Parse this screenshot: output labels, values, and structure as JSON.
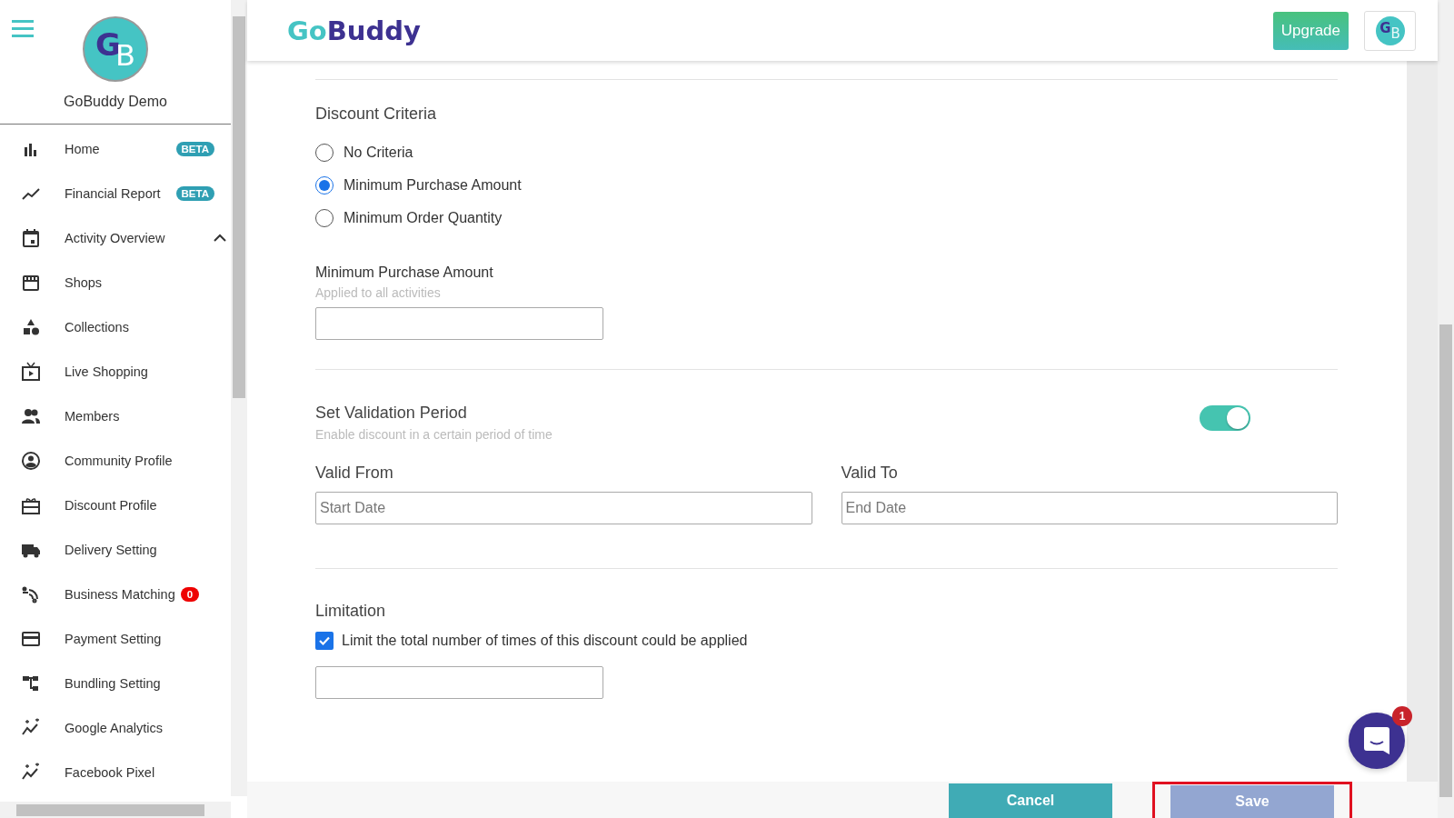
{
  "sidebar": {
    "profile_name": "GoBuddy Demo",
    "avatar_letters": [
      "G",
      "B"
    ],
    "items": [
      {
        "label": "Home",
        "kind": "beta",
        "badge": "BETA"
      },
      {
        "label": "Financial Report",
        "kind": "beta",
        "badge": "BETA"
      },
      {
        "label": "Activity Overview",
        "kind": "group",
        "expanded": true
      },
      {
        "label": "Shops",
        "kind": "plain"
      },
      {
        "label": "Collections",
        "kind": "plain"
      },
      {
        "label": "Live Shopping",
        "kind": "plain"
      },
      {
        "label": "Members",
        "kind": "plain"
      },
      {
        "label": "Community Profile",
        "kind": "plain"
      },
      {
        "label": "Discount Profile",
        "kind": "plain"
      },
      {
        "label": "Delivery Setting",
        "kind": "plain"
      },
      {
        "label": "Business Matching",
        "kind": "counter",
        "badge": "0"
      },
      {
        "label": "Payment Setting",
        "kind": "plain"
      },
      {
        "label": "Bundling Setting",
        "kind": "plain"
      },
      {
        "label": "Google Analytics",
        "kind": "plain"
      },
      {
        "label": "Facebook Pixel",
        "kind": "plain"
      }
    ]
  },
  "header": {
    "logo_parts": [
      "Go",
      "Buddy"
    ],
    "upgrade_button": "Upgrade",
    "avatar_letters": [
      "G",
      "B"
    ]
  },
  "criteria": {
    "title": "Discount Criteria",
    "options": [
      {
        "label": "No Criteria",
        "selected": false
      },
      {
        "label": "Minimum Purchase Amount",
        "selected": true
      },
      {
        "label": "Minimum Order Quantity",
        "selected": false
      }
    ],
    "amount_label": "Minimum Purchase Amount",
    "amount_hint": "Applied to all activities"
  },
  "validation": {
    "title": "Set Validation Period",
    "hint": "Enable discount in a certain period of time",
    "on": true,
    "from_label": "Valid From",
    "from_placeholder": "Start Date",
    "to_label": "Valid To",
    "to_placeholder": "End Date"
  },
  "limitation": {
    "title": "Limitation",
    "checkbox_label": "Limit the total number of times of this discount could be applied",
    "checked": true
  },
  "chat": {
    "badge": "1"
  },
  "footer": {
    "cancel": "Cancel",
    "save": "Save"
  }
}
